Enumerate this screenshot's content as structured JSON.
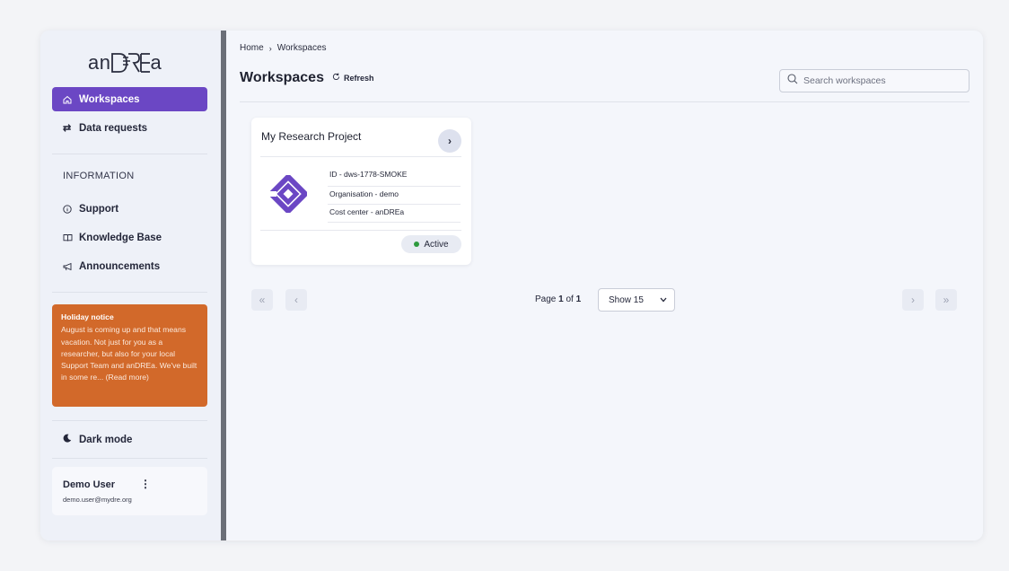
{
  "app": {
    "logo_text": "an",
    "logo_suffix": "a"
  },
  "sidebar": {
    "nav": [
      {
        "label": "Workspaces",
        "icon": "home-icon",
        "active": true
      },
      {
        "label": "Data requests",
        "icon": "swap-arrows-icon",
        "active": false
      }
    ],
    "info_title": "INFORMATION",
    "info_items": [
      {
        "label": "Support",
        "icon": "info-icon"
      },
      {
        "label": "Knowledge Base",
        "icon": "book-icon"
      },
      {
        "label": "Announcements",
        "icon": "megaphone-icon"
      }
    ],
    "notice": {
      "title": "Holiday notice",
      "body": "August is coming up and that means vacation. Not just for you as a researcher, but also for your local Support Team and anDREa. We've built in some re... (Read more)"
    },
    "dark_mode_label": "Dark mode",
    "user": {
      "name": "Demo User",
      "email": "demo.user@mydre.org",
      "menu_glyph": "⋮"
    }
  },
  "main": {
    "breadcrumb": [
      "Home",
      "Workspaces"
    ],
    "title": "Workspaces",
    "refresh_label": "Refresh",
    "search_placeholder": "Search workspaces",
    "card": {
      "title": "My Research Project",
      "meta": [
        "ID - dws-1778-SMOKE",
        "Organisation - demo",
        "Cost center - anDREa"
      ],
      "status": "Active"
    },
    "pagination": {
      "page_prefix": "Page ",
      "current": "1",
      "of_label": " of ",
      "total": "1",
      "show_label": "Show 15"
    }
  },
  "colors": {
    "accent": "#6b47c4",
    "notice_bg": "#d2692a",
    "status_active": "#2e9a3e"
  }
}
